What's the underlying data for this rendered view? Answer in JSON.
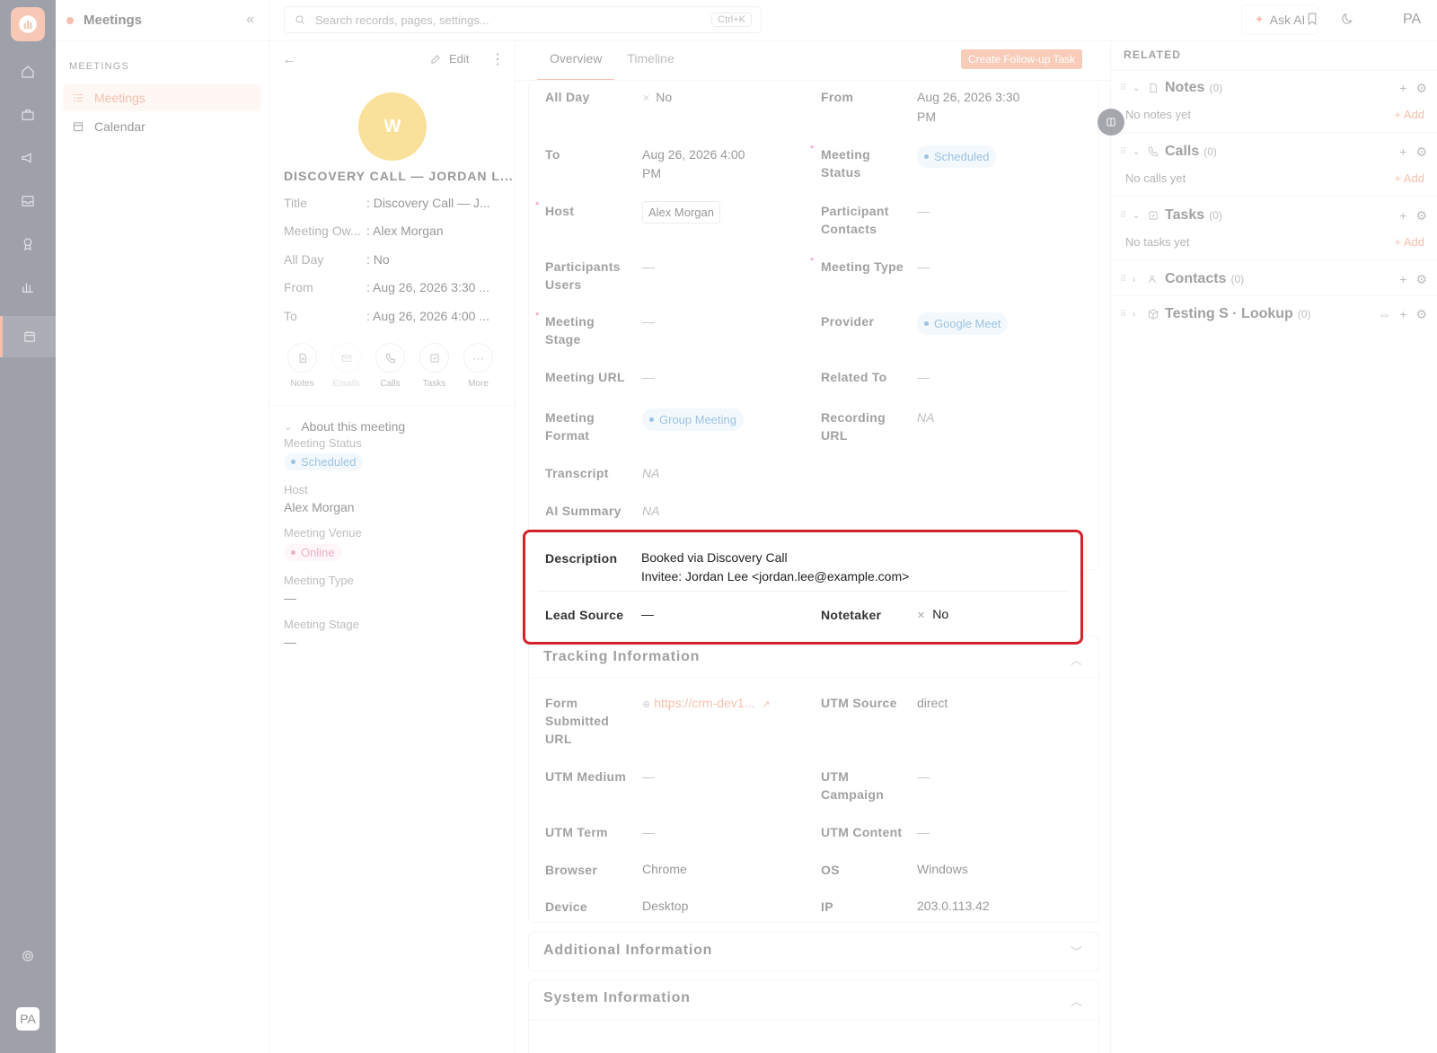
{
  "app": {
    "module_title": "Meetings",
    "section_label": "MEETINGS",
    "nav": [
      {
        "label": "Meetings"
      },
      {
        "label": "Calendar"
      }
    ],
    "user_initials": "PA"
  },
  "topbar": {
    "search_placeholder": "Search records, pages, settings...",
    "shortcut": "Ctrl+K",
    "ask_ai": "Ask AI",
    "user_initials": "PA"
  },
  "record": {
    "avatar_letter": "W",
    "name": "DISCOVERY CALL — JORDAN L...",
    "edit_label": "Edit",
    "summary": [
      {
        "label": "Title",
        "value": ": Discovery Call — J..."
      },
      {
        "label": "Meeting Ow...",
        "value": ": Alex Morgan"
      },
      {
        "label": "All Day",
        "value": ": No"
      },
      {
        "label": "From",
        "value": ": Aug 26, 2026 3:30 ..."
      },
      {
        "label": "To",
        "value": ": Aug 26, 2026 4:00 ..."
      }
    ],
    "actions": [
      {
        "label": "Notes"
      },
      {
        "label": "Emails"
      },
      {
        "label": "Calls"
      },
      {
        "label": "Tasks"
      },
      {
        "label": "More"
      }
    ],
    "about": {
      "title": "About this meeting",
      "meeting_status_label": "Meeting Status",
      "meeting_status": "Scheduled",
      "host_label": "Host",
      "host": "Alex Morgan",
      "venue_label": "Meeting Venue",
      "venue": "Online",
      "type_label": "Meeting Type",
      "type": "—",
      "stage_label": "Meeting Stage",
      "stage": "—"
    }
  },
  "tabs": [
    {
      "label": "Overview"
    },
    {
      "label": "Timeline"
    }
  ],
  "create_followup": "Create Follow-up Task",
  "fields": {
    "all_day_label": "All Day",
    "all_day_value": "No",
    "from_label": "From",
    "from_value_1": "Aug 26, 2026 3:30",
    "from_value_2": "PM",
    "to_label": "To",
    "to_value_1": "Aug 26, 2026 4:00",
    "to_value_2": "PM",
    "status_label_1": "Meeting",
    "status_label_2": "Status",
    "status_value": "Scheduled",
    "host_label": "Host",
    "host_value": "Alex Morgan",
    "pc_label_1": "Participant",
    "pc_label_2": "Contacts",
    "pc_value": "—",
    "pu_label_1": "Participants",
    "pu_label_2": "Users",
    "pu_value": "—",
    "mtype_label": "Meeting Type",
    "mtype_value": "—",
    "mstage_label_1": "Meeting",
    "mstage_label_2": "Stage",
    "mstage_value": "—",
    "provider_label": "Provider",
    "provider_value": "Google Meet",
    "url_label": "Meeting URL",
    "url_value": "—",
    "related_label": "Related To",
    "related_value": "—",
    "format_label_1": "Meeting",
    "format_label_2": "Format",
    "format_value": "Group Meeting",
    "recording_label_1": "Recording",
    "recording_label_2": "URL",
    "recording_value": "NA",
    "transcript_label": "Transcript",
    "transcript_value": "NA",
    "ai_label": "AI Summary",
    "ai_value": "NA",
    "desc_label": "Description",
    "desc_line_1": "Booked via Discovery Call",
    "desc_line_2": "Invitee: Jordan Lee <jordan.lee@example.com>",
    "lead_label": "Lead Source",
    "lead_value": "—",
    "notetaker_label": "Notetaker",
    "notetaker_value": "No"
  },
  "tracking": {
    "title": "Tracking Information",
    "form_label_1": "Form",
    "form_label_2": "Submitted",
    "form_label_3": "URL",
    "form_value": "https://crm-dev1...",
    "utm_source_label": "UTM Source",
    "utm_source_value": "direct",
    "utm_medium_label": "UTM Medium",
    "utm_medium_value": "—",
    "utm_campaign_label_1": "UTM",
    "utm_campaign_label_2": "Campaign",
    "utm_campaign_value": "—",
    "utm_term_label": "UTM Term",
    "utm_term_value": "—",
    "utm_content_label": "UTM Content",
    "utm_content_value": "—",
    "browser_label": "Browser",
    "browser_value": "Chrome",
    "os_label": "OS",
    "os_value": "Windows",
    "device_label": "Device",
    "device_value": "Desktop",
    "ip_label": "IP",
    "ip_value": "203.0.113.42"
  },
  "additional": {
    "title": "Additional Information"
  },
  "system": {
    "title": "System Information"
  },
  "related": {
    "heading": "RELATED",
    "add_label": "+ Add",
    "notes": {
      "title": "Notes",
      "count": "(0)",
      "empty": "No notes yet"
    },
    "calls": {
      "title": "Calls",
      "count": "(0)",
      "empty": "No calls yet"
    },
    "tasks": {
      "title": "Tasks",
      "count": "(0)",
      "empty": "No tasks yet"
    },
    "contacts": {
      "title": "Contacts",
      "count": "(0)"
    },
    "lookup": {
      "title": "Testing S · Lookup",
      "count": "(0)"
    }
  },
  "colors": {
    "accent": "#f08b6a",
    "highlight_border": "#d2232a",
    "rail": "#4f5563"
  }
}
